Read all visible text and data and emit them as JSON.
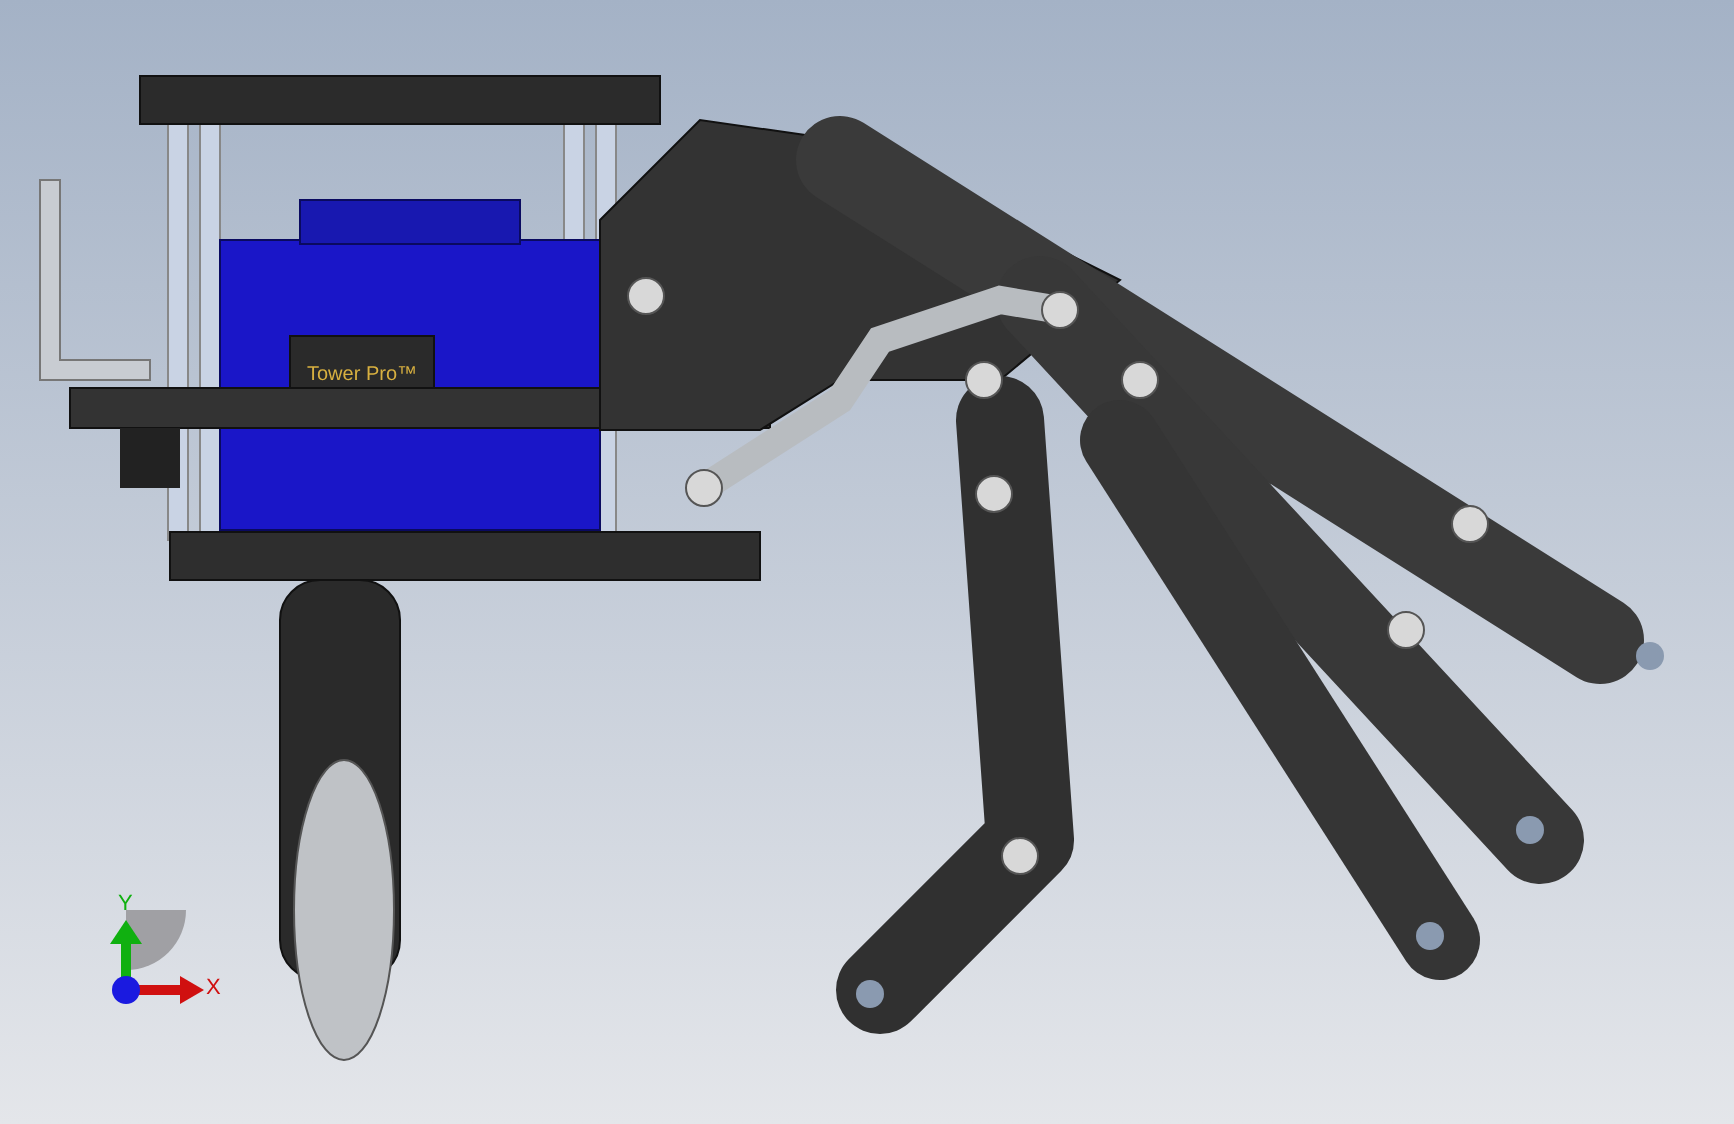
{
  "model": {
    "servo_label": "Tower Pro™"
  },
  "triad": {
    "y_label": "Y",
    "x_label": "X"
  }
}
